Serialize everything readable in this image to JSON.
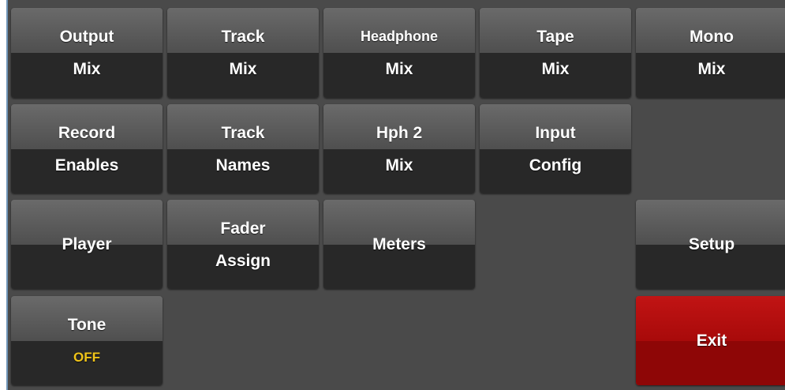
{
  "buttons": {
    "output_mix": {
      "line1": "Output",
      "line2": "Mix"
    },
    "track_mix": {
      "line1": "Track",
      "line2": "Mix"
    },
    "headphone_mix": {
      "line1": "Headphone",
      "line2": "Mix"
    },
    "tape_mix": {
      "line1": "Tape",
      "line2": "Mix"
    },
    "mono_mix": {
      "line1": "Mono",
      "line2": "Mix"
    },
    "record_enables": {
      "line1": "Record",
      "line2": "Enables"
    },
    "track_names": {
      "line1": "Track",
      "line2": "Names"
    },
    "hph2_mix": {
      "line1": "Hph 2",
      "line2": "Mix"
    },
    "input_config": {
      "line1": "Input",
      "line2": "Config"
    },
    "player": {
      "line1": "Player"
    },
    "fader_assign": {
      "line1": "Fader",
      "line2": "Assign"
    },
    "meters": {
      "line1": "Meters"
    },
    "setup": {
      "line1": "Setup"
    },
    "tone": {
      "line1": "Tone",
      "line2": "OFF"
    },
    "exit": {
      "line1": "Exit"
    }
  },
  "colors": {
    "panel_bg": "#4a4a4a",
    "button_top": "#6a6a6a",
    "button_bottom": "#282828",
    "exit_red": "#b10d0d",
    "state_yellow": "#f0c419"
  }
}
